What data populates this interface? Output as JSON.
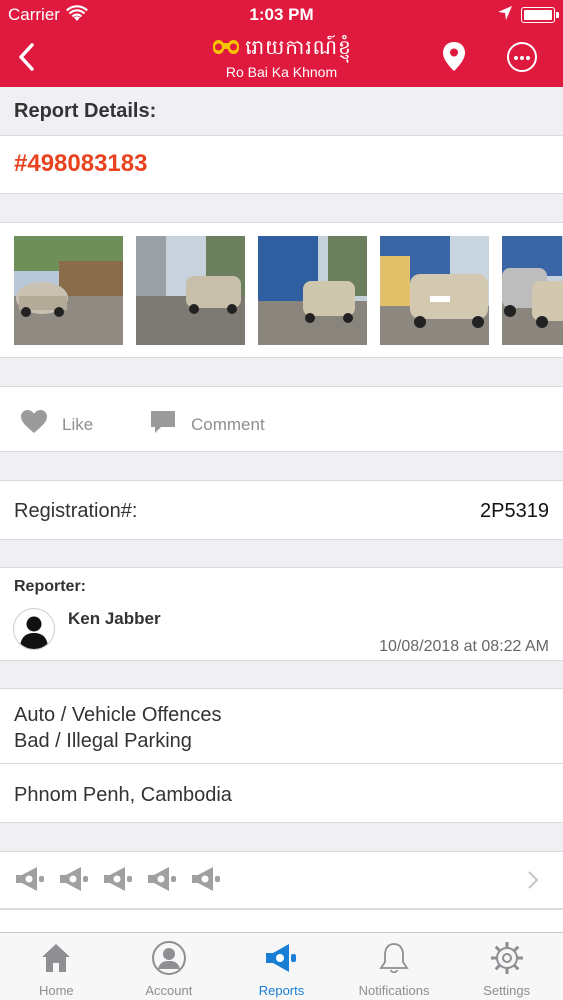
{
  "status_bar": {
    "carrier": "Carrier",
    "time": "1:03 PM"
  },
  "nav": {
    "logo_khmer": "រោយការណ៍ខ្ញុំ",
    "logo_subtitle": "Ro Bai Ka Khnom"
  },
  "report": {
    "header": "Report Details:",
    "id": "#498083183",
    "photos": [
      {
        "name": "photo-1"
      },
      {
        "name": "photo-2"
      },
      {
        "name": "photo-3"
      },
      {
        "name": "photo-4"
      },
      {
        "name": "photo-5"
      }
    ],
    "actions": {
      "like_label": "Like",
      "comment_label": "Comment"
    },
    "registration": {
      "label": "Registration#:",
      "value": "2P5319"
    },
    "reporter": {
      "label": "Reporter:",
      "name": "Ken Jabber",
      "datetime": "10/08/2018 at 08:22 AM"
    },
    "category": {
      "line1": "Auto / Vehicle Offences",
      "line2": "Bad / Illegal Parking"
    },
    "location": "Phnom Penh, Cambodia",
    "rating_icons": 5
  },
  "tabbar": {
    "tabs": [
      {
        "label": "Home",
        "icon": "home-icon"
      },
      {
        "label": "Account",
        "icon": "account-icon"
      },
      {
        "label": "Reports",
        "icon": "megaphone-icon"
      },
      {
        "label": "Notifications",
        "icon": "bell-icon"
      },
      {
        "label": "Settings",
        "icon": "gear-icon"
      }
    ],
    "active": "Reports"
  },
  "colors": {
    "brand_red": "#e0193f",
    "id_orange": "#e8421e",
    "active_blue": "#1a7fd4",
    "inactive_gray": "#8e8e93"
  }
}
